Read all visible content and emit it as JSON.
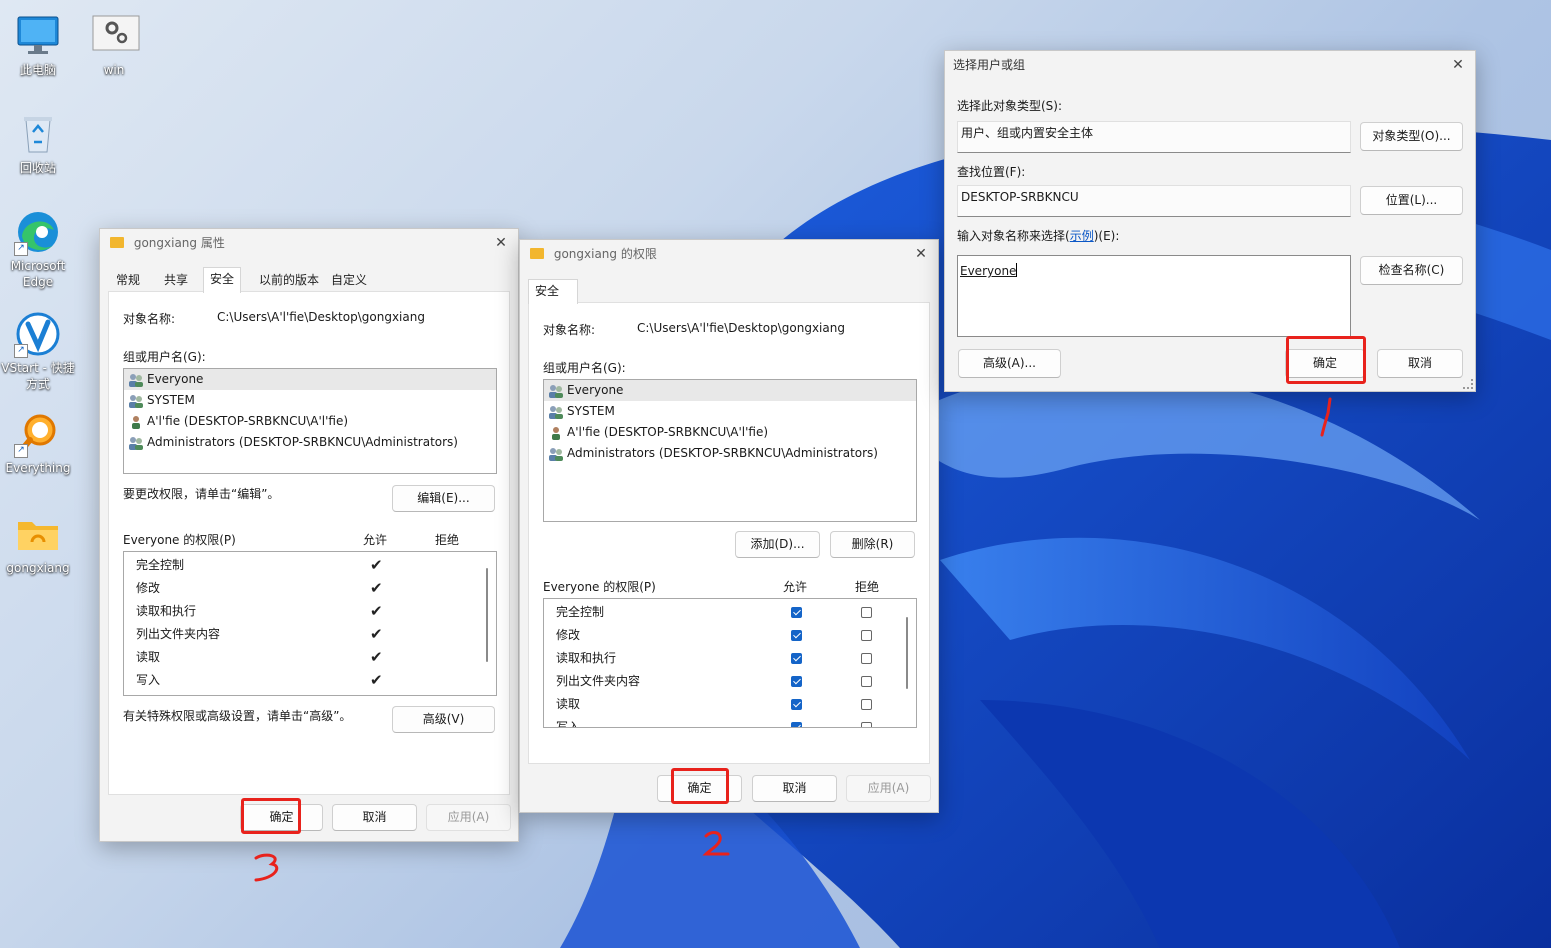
{
  "desktop": {
    "icons": [
      {
        "label": "此电脑",
        "icon": "monitor-icon"
      },
      {
        "label": "win",
        "icon": "settings-file-icon"
      },
      {
        "label": "回收站",
        "icon": "recycle-bin-icon"
      },
      {
        "label": "Microsoft Edge",
        "icon": "edge-icon"
      },
      {
        "label": "VStart - 快捷方式",
        "icon": "vstart-icon"
      },
      {
        "label": "Everything",
        "icon": "everything-search-icon"
      },
      {
        "label": "gongxiang",
        "icon": "shared-folder-icon"
      }
    ]
  },
  "properties_dialog": {
    "title": "gongxiang 属性",
    "tabs": [
      "常规",
      "共享",
      "安全",
      "以前的版本",
      "自定义"
    ],
    "active_tab": "安全",
    "object_label": "对象名称:",
    "object_value": "C:\\Users\\A'l'fie\\Desktop\\gongxiang",
    "group_label": "组或用户名(G):",
    "users": [
      "Everyone",
      "SYSTEM",
      "A'l'fie (DESKTOP-SRBKNCU\\A'l'fie)",
      "Administrators (DESKTOP-SRBKNCU\\Administrators)"
    ],
    "edit_hint": "要更改权限，请单击“编辑”。",
    "edit_button": "编辑(E)...",
    "perm_label": "Everyone 的权限(P)",
    "allow_header": "允许",
    "deny_header": "拒绝",
    "permissions": [
      {
        "name": "完全控制",
        "allow": true,
        "deny": false
      },
      {
        "name": "修改",
        "allow": true,
        "deny": false
      },
      {
        "name": "读取和执行",
        "allow": true,
        "deny": false
      },
      {
        "name": "列出文件夹内容",
        "allow": true,
        "deny": false
      },
      {
        "name": "读取",
        "allow": true,
        "deny": false
      },
      {
        "name": "写入",
        "allow": true,
        "deny": false
      }
    ],
    "advanced_hint": "有关特殊权限或高级设置，请单击“高级”。",
    "advanced_button": "高级(V)",
    "ok": "确定",
    "cancel": "取消",
    "apply": "应用(A)"
  },
  "permissions_dialog": {
    "title": "gongxiang 的权限",
    "tab": "安全",
    "object_label": "对象名称:",
    "object_value": "C:\\Users\\A'l'fie\\Desktop\\gongxiang",
    "group_label": "组或用户名(G):",
    "users": [
      "Everyone",
      "SYSTEM",
      "A'l'fie (DESKTOP-SRBKNCU\\A'l'fie)",
      "Administrators (DESKTOP-SRBKNCU\\Administrators)"
    ],
    "add_button": "添加(D)...",
    "remove_button": "删除(R)",
    "perm_label": "Everyone 的权限(P)",
    "allow_header": "允许",
    "deny_header": "拒绝",
    "permissions": [
      {
        "name": "完全控制",
        "allow": true,
        "deny": false
      },
      {
        "name": "修改",
        "allow": true,
        "deny": false
      },
      {
        "name": "读取和执行",
        "allow": true,
        "deny": false
      },
      {
        "name": "列出文件夹内容",
        "allow": true,
        "deny": false
      },
      {
        "name": "读取",
        "allow": true,
        "deny": false
      },
      {
        "name": "写入",
        "allow": true,
        "deny": false
      }
    ],
    "ok": "确定",
    "cancel": "取消",
    "apply": "应用(A)"
  },
  "select_dialog": {
    "title": "选择用户或组",
    "object_type_label": "选择此对象类型(S):",
    "object_type_value": "用户、组或内置安全主体",
    "object_type_button": "对象类型(O)...",
    "location_label": "查找位置(F):",
    "location_value": "DESKTOP-SRBKNCU",
    "location_button": "位置(L)...",
    "names_label_pre": "输入对象名称来选择(",
    "names_label_link": "示例",
    "names_label_post": ")(E):",
    "names_value": "Everyone",
    "check_names_button": "检查名称(C)",
    "advanced_button": "高级(A)...",
    "ok": "确定",
    "cancel": "取消"
  },
  "annotations": {
    "step1": "1",
    "step2": "2",
    "step3": "3",
    "color": "#e8221c"
  }
}
